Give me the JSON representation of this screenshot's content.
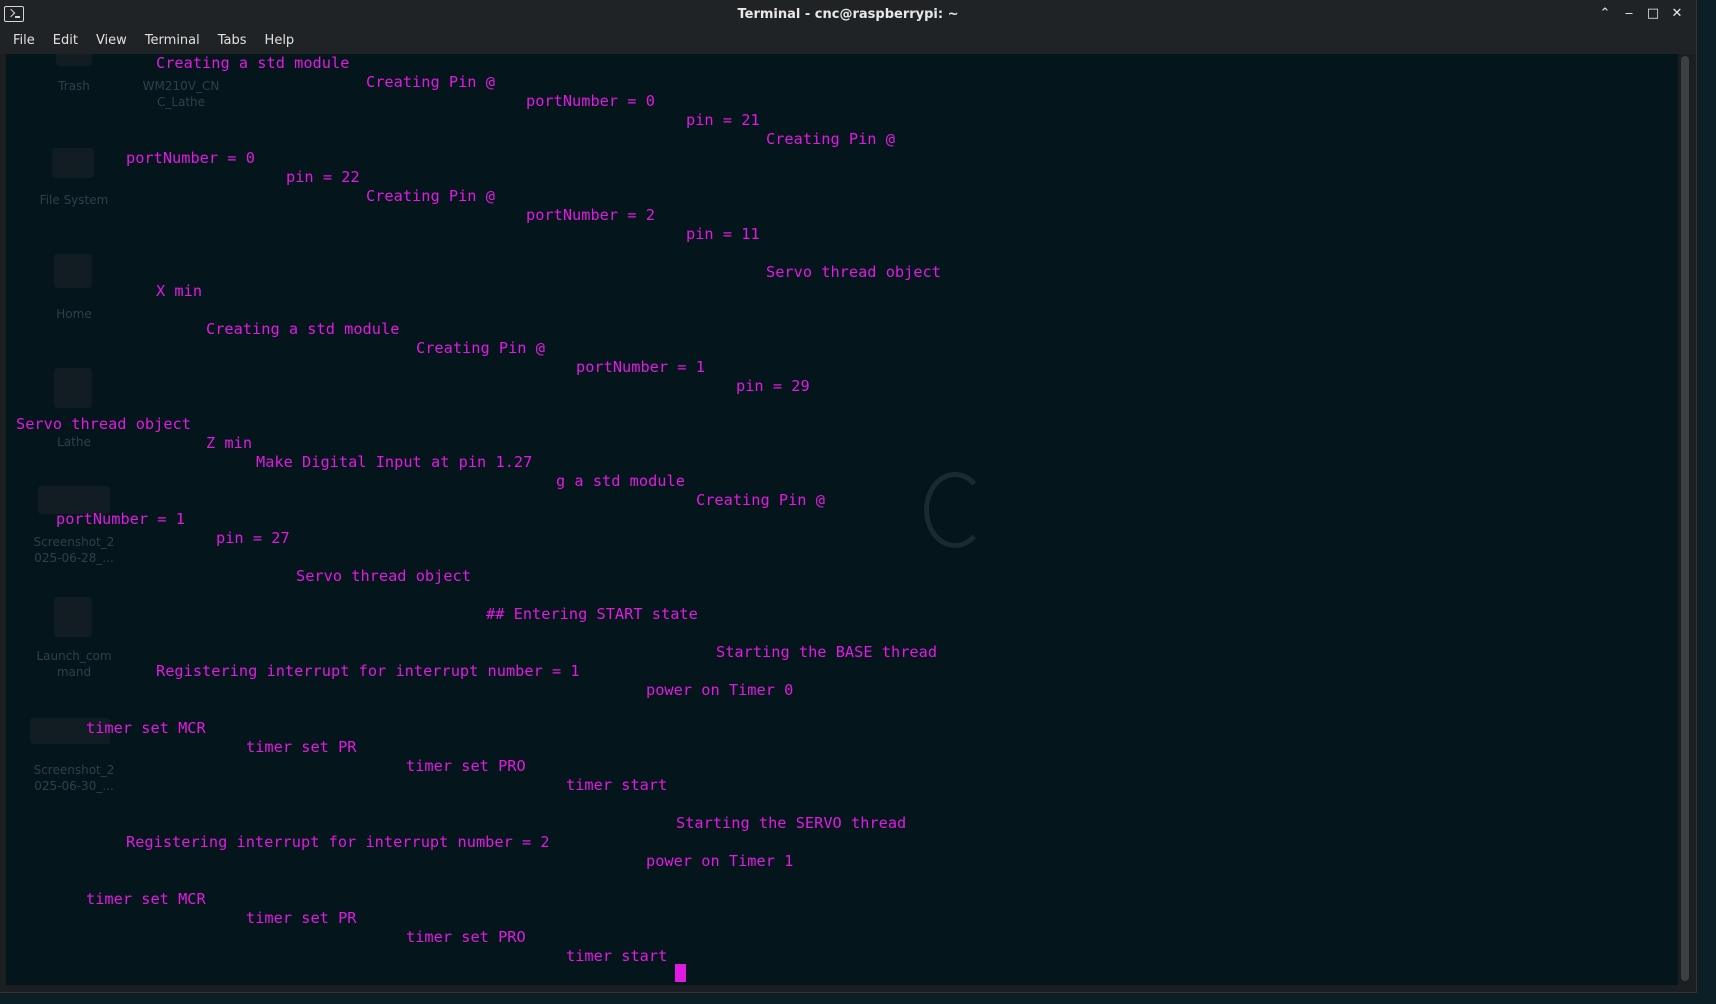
{
  "window": {
    "title": "Terminal - cnc@raspberrypi: ~"
  },
  "menu": [
    "File",
    "Edit",
    "View",
    "Terminal",
    "Tabs",
    "Help"
  ],
  "desktop_labels": [
    "Trash",
    "WM210V_CN",
    "C_Lathe",
    "File System",
    "Home",
    "Lathe",
    "Screenshot_2",
    "025-06-28_...",
    "Launch_com",
    "mand",
    "Screenshot_2",
    "025-06-30_..."
  ],
  "terminal_lines": [
    "Creating a std module",
    "Creating Pin @",
    "portNumber = 0",
    "pin = 21",
    "Creating Pin @",
    "portNumber = 0",
    "pin = 22",
    "Creating Pin @",
    "portNumber = 2",
    "pin = 11",
    "Servo thread object",
    "X min",
    "Creating a std module",
    "Creating Pin @",
    "portNumber = 1",
    "pin = 29",
    "Servo thread object",
    "Z min",
    "Make Digital Input at pin 1.27",
    "g a std module",
    "Creating Pin @",
    "portNumber = 1",
    "pin = 27",
    "Servo thread object",
    "## Entering START state",
    "Starting the BASE thread",
    "Registering interrupt for interrupt number = 1",
    "power on Timer 0",
    "timer set MCR",
    "timer set PR",
    "timer set PRO",
    "timer start",
    "Starting the SERVO thread",
    "Registering interrupt for interrupt number = 2",
    "power on Timer 1",
    "timer set MCR",
    "timer set PR",
    "timer set PRO",
    "timer start"
  ],
  "colors": {
    "terminal_text": "#e01ae0",
    "terminal_bg": "#04161c"
  }
}
